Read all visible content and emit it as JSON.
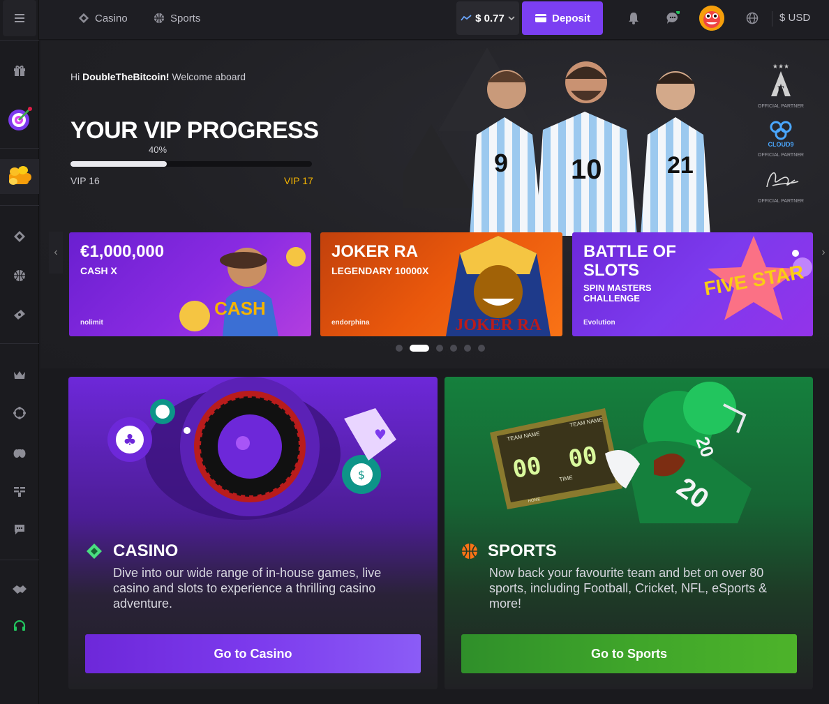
{
  "topbar": {
    "nav": [
      {
        "label": "Casino",
        "icon": "casino-diamond-icon"
      },
      {
        "label": "Sports",
        "icon": "basketball-icon"
      }
    ],
    "balance": "$ 0.77",
    "deposit_label": "Deposit",
    "currency": "$ USD"
  },
  "sidebar": {
    "icons": [
      "menu-icon",
      "gift-icon",
      "target-promo-icon",
      "coins-icon",
      "casino-diamond-icon",
      "basketball-icon",
      "ticket-icon",
      "crown-icon",
      "settings-circle-icon",
      "binoculars-icon",
      "leaderboard-icon",
      "chat-icon",
      "handshake-icon",
      "support-headset-icon"
    ]
  },
  "hero": {
    "greeting_prefix": "Hi",
    "username": "DoubleTheBitcoin!",
    "greeting_suffix": "Welcome aboard",
    "vip_title": "YOUR VIP PROGRESS",
    "vip_progress_label": "40%",
    "vip_progress": 0.4,
    "vip_current": "VIP 16",
    "vip_next": "VIP 17",
    "partners": [
      {
        "name": "AFA",
        "label": "OFFICIAL PARTNER"
      },
      {
        "name": "CLOUD9",
        "label": "OFFICIAL PARTNER"
      },
      {
        "name": "signature",
        "label": "OFFICIAL PARTNER"
      }
    ],
    "jersey_numbers": [
      "9",
      "10",
      "21"
    ]
  },
  "promos": [
    {
      "title": "€1,000,000",
      "subtitle": "CASH X",
      "provider": "nolimit",
      "art_text": "CASH"
    },
    {
      "title": "JOKER RA",
      "subtitle": "LEGENDARY 10000X",
      "provider": "endorphina",
      "art_text": "JOKER RA"
    },
    {
      "title": "BATTLE OF SLOTS",
      "subtitle": "SPIN MASTERS CHALLENGE",
      "provider": "Evolution",
      "art_text": "FIVE STAR"
    }
  ],
  "carousel": {
    "count": 6,
    "active": 1
  },
  "cards": {
    "casino": {
      "title": "CASINO",
      "description": "Dive into our wide range of in-house games, live casino and slots to experience a thrilling casino adventure.",
      "button": "Go to Casino",
      "color": "#7c3aed"
    },
    "sports": {
      "title": "SPORTS",
      "description": "Now back your favourite team and bet on over 80 sports, including Football, Cricket, NFL, eSports & more!",
      "button": "Go to Sports",
      "color": "#3fa52a",
      "scoreboard": {
        "team_a": "TEAM NAME",
        "team_b": "TEAM NAME",
        "score_a": "00",
        "score_b": "00",
        "time": "TIME",
        "home": "HOME",
        "jersey": "20"
      }
    }
  }
}
